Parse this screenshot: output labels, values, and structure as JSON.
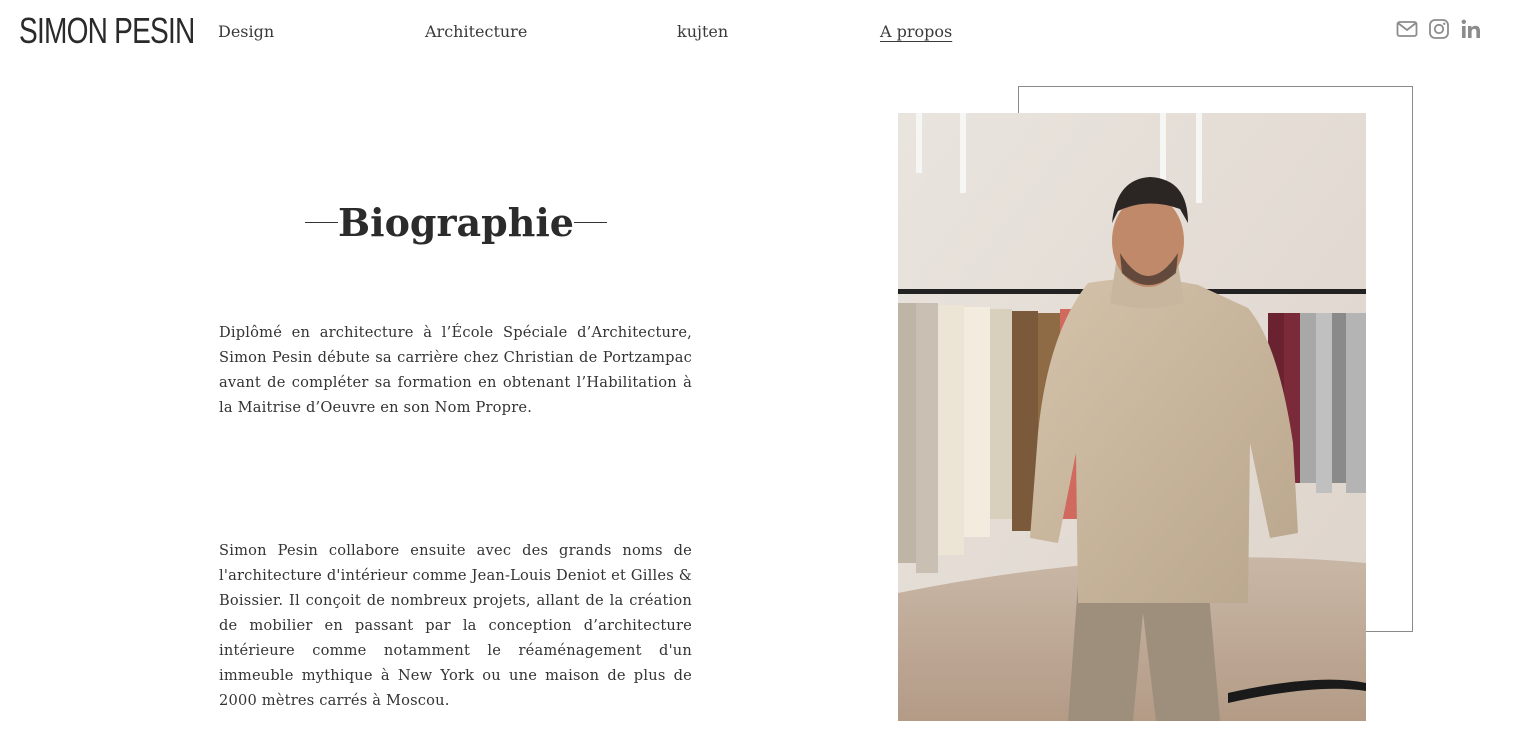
{
  "header": {
    "logo": "SIMON PESIN",
    "nav": [
      {
        "label": "Design"
      },
      {
        "label": "Architecture"
      },
      {
        "label": "kujten"
      },
      {
        "label": "A propos",
        "active": true
      }
    ],
    "social": [
      "mail-icon",
      "instagram-icon",
      "linkedin-icon"
    ]
  },
  "main": {
    "title": "Biographie",
    "paragraphs": [
      "Diplômé en architecture à l’École Spéciale d’Architecture, Simon Pesin débute sa carrière chez Christian de Portzampac avant de compléter sa formation en obtenant l’Habilitation à la Maitrise d’Oeuvre en son Nom Propre.",
      "Simon Pesin collabore ensuite avec des grands noms de l'architecture d'intérieur comme Jean-Louis Deniot et Gilles & Boissier. Il conçoit de nombreux projets, allant de la création de mobilier en passant par la conception d’architecture intérieure comme notamment le réaménagement d'un immeuble mythique à New York ou une maison de plus de 2000 mètres carrés à Moscou."
    ]
  },
  "colors": {
    "text": "#2b2b2b",
    "icon": "#8c8c8c",
    "frame": "#8a8a8a"
  }
}
